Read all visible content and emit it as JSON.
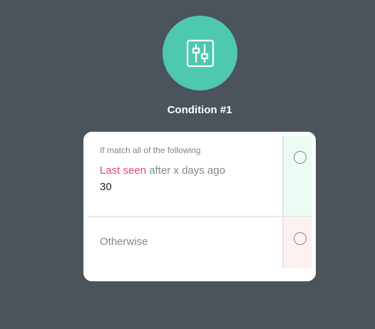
{
  "node": {
    "icon": "sliders-icon",
    "title": "Condition #1",
    "accent_color": "#4ec9b0"
  },
  "condition": {
    "heading": "If match all of the following",
    "rule": {
      "key": "Last seen",
      "operator": "after x days ago",
      "value": "30"
    },
    "otherwise_label": "Otherwise"
  },
  "colors": {
    "background": "#4b545a",
    "rule_key": "#e0457b",
    "success_port_bg": "#ecfcf4",
    "failure_port_bg": "#fdf1f0"
  }
}
